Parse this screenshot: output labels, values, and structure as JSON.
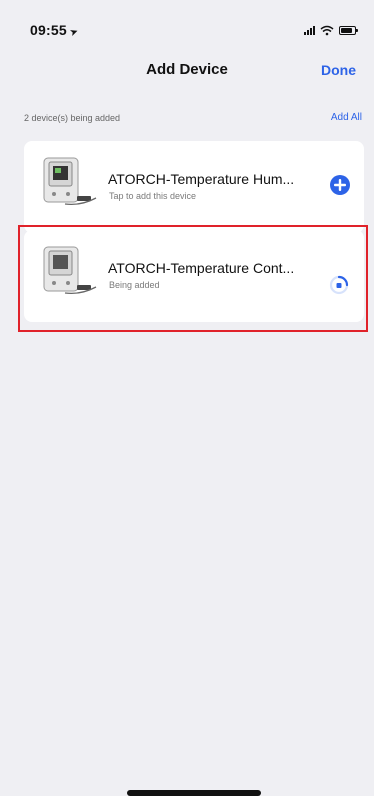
{
  "status": {
    "time": "09:55"
  },
  "nav": {
    "title": "Add Device",
    "done_label": "Done"
  },
  "section": {
    "count_text": "2 device(s) being added",
    "add_all_label": "Add All"
  },
  "devices": [
    {
      "name": "ATORCH-Temperature Hum...",
      "subtitle": "Tap to add this device",
      "action_icon": "add-circle-icon"
    },
    {
      "name": "ATORCH-Temperature Cont...",
      "subtitle": "Being added",
      "action_icon": "loading-icon"
    }
  ],
  "colors": {
    "accent": "#2d63e7",
    "highlight": "#e0222a",
    "background": "#efeff3"
  }
}
